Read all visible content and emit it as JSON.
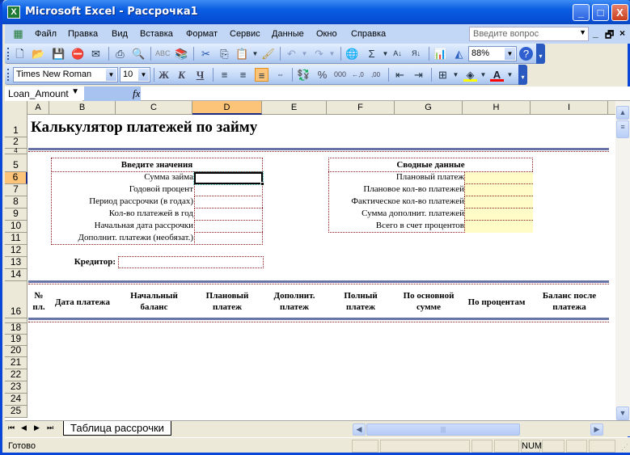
{
  "window": {
    "title": "Microsoft Excel - Рассрочка1",
    "minimize": "_",
    "maximize": "□",
    "close": "X"
  },
  "menu": {
    "items": [
      "Файл",
      "Правка",
      "Вид",
      "Вставка",
      "Формат",
      "Сервис",
      "Данные",
      "Окно",
      "Справка"
    ],
    "ask_placeholder": "Введите вопрос",
    "doc_min": "_",
    "doc_restore": "🗗",
    "doc_close": "×"
  },
  "standard_toolbar": {
    "zoom": "88%",
    "icons": [
      "new-icon",
      "open-icon",
      "save-icon",
      "permission-icon",
      "email-icon",
      "print-icon",
      "print-preview-icon",
      "spelling-icon",
      "research-icon",
      "cut-icon",
      "copy-icon",
      "paste-icon",
      "format-painter-icon",
      "undo-icon",
      "redo-icon",
      "hyperlink-icon",
      "autosum-icon",
      "sort-asc-icon",
      "sort-desc-icon",
      "chart-wizard-icon",
      "drawing-icon",
      "help-icon"
    ]
  },
  "format_toolbar": {
    "font": "Times New Roman",
    "size": "10",
    "bold": "Ж",
    "italic": "К",
    "underline": "Ч",
    "percent": "%",
    "thousands": "000",
    "inc_decimal": "←,0",
    "dec_decimal": ",00",
    "fill_color": "#ffff00",
    "font_color": "#ff0000",
    "font_color_glyph": "A",
    "active_align": "align-right"
  },
  "formula_bar": {
    "name_box": "Loan_Amount",
    "fx": "fx",
    "value": ""
  },
  "columns": [
    "A",
    "B",
    "C",
    "D",
    "E",
    "F",
    "G",
    "H",
    "I"
  ],
  "selected_column": "D",
  "rows": [
    "1",
    "2",
    "4",
    "5",
    "6",
    "7",
    "8",
    "9",
    "10",
    "11",
    "12",
    "13",
    "14",
    "16",
    "18",
    "19",
    "20",
    "21",
    "22",
    "23",
    "24",
    "25"
  ],
  "selected_row": "6",
  "sheet": {
    "title": "Калькулятор платежей по займу",
    "inputs": {
      "header": "Введите значения",
      "labels": [
        "Сумма займа",
        "Годовой процент",
        "Период рассрочки (в годах)",
        "Кол-во платежей в год",
        "Начальная дата рассрочки",
        "Дополнит. платежи (необязат.)"
      ],
      "values": [
        "",
        "",
        "",
        "",
        "",
        ""
      ]
    },
    "summary": {
      "header": "Сводные данные",
      "labels": [
        "Плановый платеж",
        "Плановое кол-во платежей",
        "Фактическое кол-во платежей",
        "Сумма дополнит. платежей",
        "Всего в счет процентов"
      ],
      "values": [
        "",
        "",
        "",
        "",
        ""
      ]
    },
    "lender_label": "Кредитор:",
    "lender_value": "",
    "table_headers": [
      "№\nпл.",
      "Дата платежа",
      "Начальный\nбаланс",
      "Плановый\nплатеж",
      "Дополнит.\nплатеж",
      "Полный\nплатеж",
      "По основной\nсумме",
      "По процентам",
      "Баланс после\nплатежа"
    ]
  },
  "tabs": {
    "nav": [
      "⏮",
      "◀",
      "▶",
      "⏭"
    ],
    "sheets": [
      "Таблица рассрочки"
    ]
  },
  "status": {
    "text": "Готово",
    "num": "NUM"
  },
  "colors": {
    "accent_border": "#8b1a1a",
    "rule": "#6a73a6",
    "output_fill": "#fffcc8",
    "selection": "#fbc478"
  }
}
